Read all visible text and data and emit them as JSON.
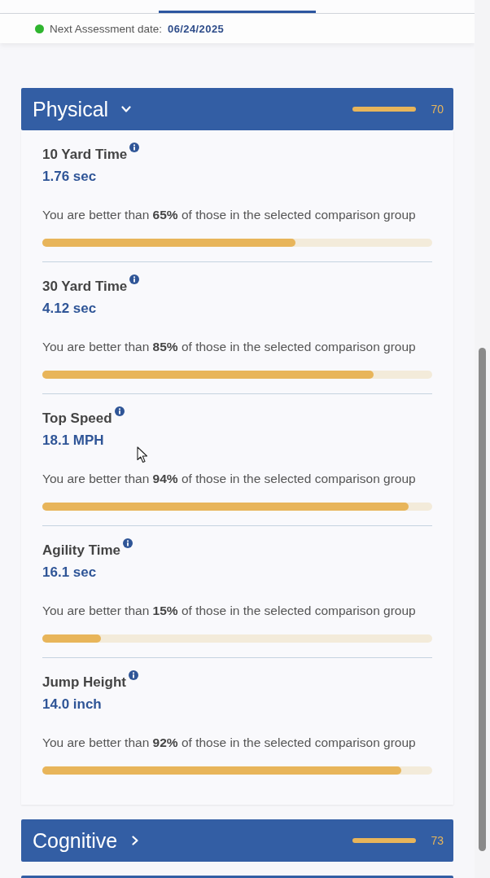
{
  "next_assessment": {
    "label": "Next Assessment date:",
    "date": "06/24/2025"
  },
  "sections": [
    {
      "title": "Physical",
      "expanded": true,
      "score": "70",
      "metrics": [
        {
          "name": "10 Yard Time",
          "value": "1.76 sec",
          "comparison": "You are better than **65%** of those in the selected comparison group",
          "level": 0.65
        },
        {
          "name": "30 Yard Time",
          "value": "4.12 sec",
          "comparison": "You are better than **85%** of those in the selected comparison group",
          "level": 0.85
        },
        {
          "name": "Top Speed",
          "value": "18.1 MPH",
          "comparison": "You are better than **94%** of those in the selected comparison group",
          "level": 0.94
        },
        {
          "name": "Agility Time",
          "value": "16.1 sec",
          "comparison": "You are better than **15%** of those in the selected comparison group",
          "level": 0.15
        },
        {
          "name": "Jump Height",
          "value": "14.0 inch",
          "comparison": "You are better than **92%** of those in the selected comparison group",
          "level": 0.92
        }
      ]
    },
    {
      "title": "Cognitive",
      "expanded": false,
      "score": "73"
    }
  ]
}
